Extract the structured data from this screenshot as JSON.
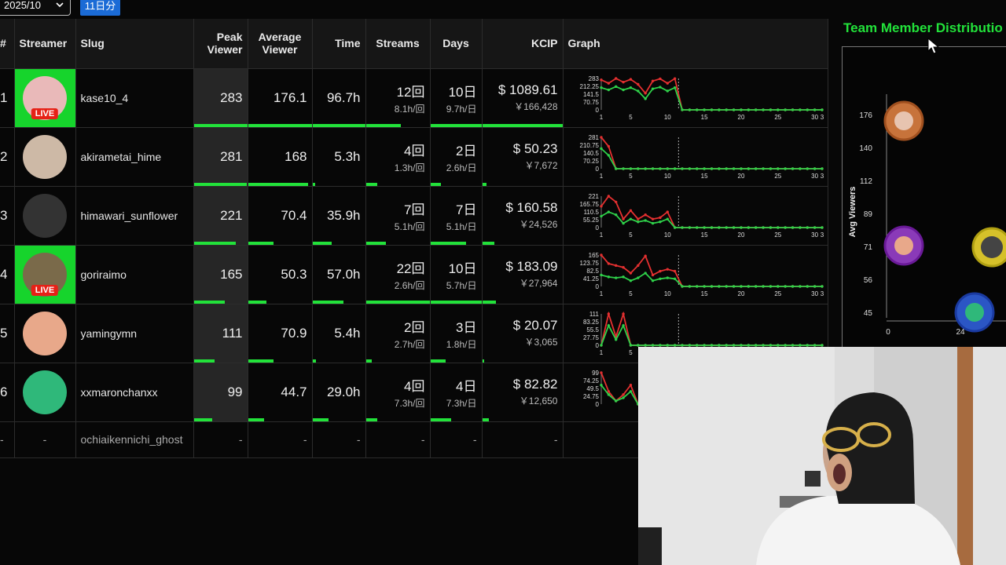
{
  "toolbar": {
    "month": "2025/10",
    "days_badge": "11日分"
  },
  "table": {
    "headers": {
      "rank": "#",
      "streamer": "Streamer",
      "slug": "Slug",
      "peak": "Peak Viewer",
      "avg": "Average Viewer",
      "time": "Time",
      "streams": "Streams",
      "days": "Days",
      "kcip": "KCIP",
      "graph": "Graph"
    },
    "rows": [
      {
        "rank": "1",
        "slug": "kase10_4",
        "live": true,
        "live_label": "LIVE",
        "avatar_color": "#e9b9b9",
        "peak": "283",
        "avg": "176.1",
        "time": "96.7h",
        "streams": "12回",
        "streams_sub": "8.1h/回",
        "days": "10日",
        "days_sub": "9.7h/日",
        "usd": "$ 1089.61",
        "jpy": "￥166,428",
        "bars": {
          "peak": 1.0,
          "avg": 1.0,
          "time": 1.0,
          "streams": 0.55,
          "days": 1.0,
          "kcip": 1.0
        },
        "graph": {
          "yticks": [
            "283",
            "212.25",
            "141.5",
            "70.75",
            "0"
          ],
          "xticks": [
            "1",
            "5",
            "10",
            "15",
            "20",
            "25",
            "30",
            "3"
          ],
          "peak": [
            270,
            240,
            283,
            250,
            275,
            230,
            150,
            260,
            280,
            240,
            282,
            0
          ],
          "avg": [
            200,
            180,
            210,
            180,
            200,
            170,
            100,
            190,
            205,
            170,
            200,
            0
          ]
        }
      },
      {
        "rank": "2",
        "slug": "akirametai_hime",
        "live": false,
        "avatar_color": "#cdb9a6",
        "peak": "281",
        "avg": "168",
        "time": "5.3h",
        "streams": "4回",
        "streams_sub": "1.3h/回",
        "days": "2日",
        "days_sub": "2.6h/日",
        "usd": "$ 50.23",
        "jpy": "￥7,672",
        "bars": {
          "peak": 0.99,
          "avg": 0.95,
          "time": 0.05,
          "streams": 0.18,
          "days": 0.2,
          "kcip": 0.05
        },
        "graph": {
          "yticks": [
            "281",
            "210.75",
            "140.5",
            "70.25",
            "0"
          ],
          "xticks": [
            "1",
            "5",
            "10",
            "15",
            "20",
            "25",
            "30",
            "3"
          ],
          "peak": [
            281,
            200,
            0,
            0,
            0,
            0,
            0,
            0,
            0,
            0,
            0,
            0
          ],
          "avg": [
            180,
            120,
            0,
            0,
            0,
            0,
            0,
            0,
            0,
            0,
            0,
            0
          ]
        }
      },
      {
        "rank": "3",
        "slug": "himawari_sunflower",
        "live": false,
        "avatar_color": "#333333",
        "peak": "221",
        "avg": "70.4",
        "time": "35.9h",
        "streams": "7回",
        "streams_sub": "5.1h/回",
        "days": "7日",
        "days_sub": "5.1h/日",
        "usd": "$ 160.58",
        "jpy": "￥24,526",
        "bars": {
          "peak": 0.78,
          "avg": 0.4,
          "time": 0.37,
          "streams": 0.32,
          "days": 0.7,
          "kcip": 0.15
        },
        "graph": {
          "yticks": [
            "221",
            "165.75",
            "110.5",
            "55.25",
            "0"
          ],
          "xticks": [
            "1",
            "5",
            "10",
            "15",
            "20",
            "25",
            "30",
            "3"
          ],
          "peak": [
            150,
            221,
            180,
            60,
            120,
            60,
            90,
            60,
            70,
            110,
            0,
            0
          ],
          "avg": [
            80,
            110,
            90,
            30,
            60,
            40,
            50,
            30,
            40,
            60,
            0,
            0
          ]
        }
      },
      {
        "rank": "4",
        "slug": "goriraimo",
        "live": true,
        "live_label": "LIVE",
        "avatar_color": "#7a6a4a",
        "peak": "165",
        "avg": "50.3",
        "time": "57.0h",
        "streams": "22回",
        "streams_sub": "2.6h/回",
        "days": "10日",
        "days_sub": "5.7h/日",
        "usd": "$ 183.09",
        "jpy": "￥27,964",
        "bars": {
          "peak": 0.58,
          "avg": 0.29,
          "time": 0.59,
          "streams": 1.0,
          "days": 1.0,
          "kcip": 0.17
        },
        "graph": {
          "yticks": [
            "165",
            "123.75",
            "82.5",
            "41.25",
            "0"
          ],
          "xticks": [
            "1",
            "5",
            "10",
            "15",
            "20",
            "25",
            "30",
            "3"
          ],
          "peak": [
            165,
            120,
            110,
            100,
            70,
            110,
            160,
            60,
            80,
            90,
            80,
            0
          ],
          "avg": [
            60,
            50,
            45,
            50,
            30,
            45,
            70,
            30,
            40,
            45,
            40,
            0
          ]
        }
      },
      {
        "rank": "5",
        "slug": "yamingymn",
        "live": false,
        "avatar_color": "#e8a88a",
        "peak": "111",
        "avg": "70.9",
        "time": "5.4h",
        "streams": "2回",
        "streams_sub": "2.7h/回",
        "days": "3日",
        "days_sub": "1.8h/日",
        "usd": "$ 20.07",
        "jpy": "￥3,065",
        "bars": {
          "peak": 0.39,
          "avg": 0.4,
          "time": 0.06,
          "streams": 0.09,
          "days": 0.3,
          "kcip": 0.02
        },
        "graph": {
          "yticks": [
            "111",
            "83.25",
            "55.5",
            "27.75",
            "0"
          ],
          "xticks": [
            "1",
            "5"
          ],
          "peak": [
            0,
            111,
            30,
            111,
            0
          ],
          "avg": [
            0,
            70,
            20,
            70,
            0
          ]
        }
      },
      {
        "rank": "6",
        "slug": "xxmaronchanxx",
        "live": false,
        "avatar_color": "#2fb87a",
        "peak": "99",
        "avg": "44.7",
        "time": "29.0h",
        "streams": "4回",
        "streams_sub": "7.3h/回",
        "days": "4日",
        "days_sub": "7.3h/日",
        "usd": "$ 82.82",
        "jpy": "￥12,650",
        "bars": {
          "peak": 0.35,
          "avg": 0.25,
          "time": 0.3,
          "streams": 0.18,
          "days": 0.4,
          "kcip": 0.08
        },
        "graph": {
          "yticks": [
            "99",
            "74.25",
            "49.5",
            "24.75",
            "0"
          ],
          "xticks": [],
          "peak": [
            99,
            40,
            10,
            30,
            60
          ],
          "avg": [
            60,
            30,
            10,
            20,
            40
          ]
        }
      }
    ],
    "ghost_row": {
      "rank": "-",
      "streamer": "-",
      "slug": "ochiaikennichi_ghost",
      "peak": "-",
      "avg": "-",
      "time": "-",
      "streams": "-",
      "days": "-",
      "kcip": "-"
    }
  },
  "distribution": {
    "title": "Team Member Distributio",
    "ylabel": "Avg Viewers",
    "yticks": [
      "176",
      "140",
      "112",
      "89",
      "71",
      "56",
      "45"
    ],
    "xticks": [
      "0",
      "24"
    ]
  },
  "colors": {
    "accent_green": "#22e23a",
    "peak_line": "#e53030",
    "avg_line": "#2fd14a",
    "badge_blue": "#1b6bd6",
    "live_red": "#e62117"
  }
}
